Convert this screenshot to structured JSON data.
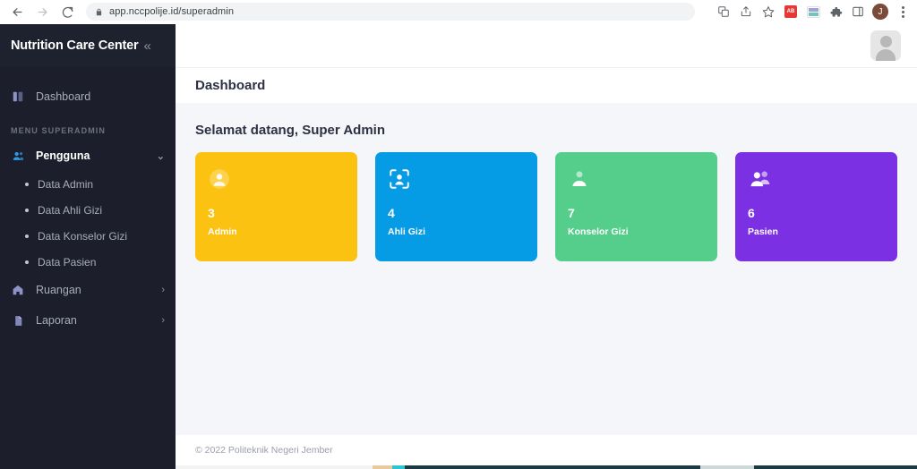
{
  "browser": {
    "back_label": "Back",
    "forward_label": "Forward",
    "reload_label": "Reload",
    "lock_icon": "lock-icon",
    "url": "app.nccpolije.id/superadmin",
    "toolbar_icons": [
      {
        "name": "translate-icon",
        "label": "Translate"
      },
      {
        "name": "share-icon",
        "label": "Share"
      },
      {
        "name": "bookmark-star-icon",
        "label": "Bookmark this tab"
      },
      {
        "name": "extension-red-icon",
        "label": "AdBlock",
        "badge": "AB"
      },
      {
        "name": "extension-wave-icon",
        "label": "Wave extension"
      },
      {
        "name": "extensions-puzzle-icon",
        "label": "Extensions"
      },
      {
        "name": "sidepanel-icon",
        "label": "Side panel"
      }
    ],
    "profile_initial": "J",
    "menu_label": "Customize and control Google Chrome"
  },
  "sidebar": {
    "brand": "Nutrition Care Center",
    "collapse_icon": "«",
    "items": [
      {
        "label": "Dashboard",
        "icon": "dashboard-icon",
        "type": "item"
      }
    ],
    "section_label": "MENU SUPERADMIN",
    "menu": [
      {
        "label": "Pengguna",
        "icon": "users-icon",
        "chevron": "⌄",
        "active": true
      },
      {
        "label": "Data Admin",
        "type": "sub"
      },
      {
        "label": "Data Ahli Gizi",
        "type": "sub"
      },
      {
        "label": "Data Konselor Gizi",
        "type": "sub"
      },
      {
        "label": "Data Pasien",
        "type": "sub"
      },
      {
        "label": "Ruangan",
        "icon": "home-icon",
        "chevron": "›"
      },
      {
        "label": "Laporan",
        "icon": "document-icon",
        "chevron": "›"
      }
    ]
  },
  "topbar": {
    "avatar_name": "user-avatar"
  },
  "page": {
    "title": "Dashboard",
    "welcome": "Selamat datang, Super Admin"
  },
  "cards": [
    {
      "count": "3",
      "label": "Admin",
      "color": "#FCC211",
      "icon": "user-circle-icon"
    },
    {
      "count": "4",
      "label": "Ahli Gizi",
      "color": "#059BE5",
      "icon": "face-scan-icon"
    },
    {
      "count": "7",
      "label": "Konselor Gizi",
      "color": "#55CE8C",
      "icon": "person-icon"
    },
    {
      "count": "6",
      "label": "Pasien",
      "color": "#7B30E3",
      "icon": "people-icon"
    }
  ],
  "footer": {
    "text": "© 2022  Politeknik Negeri Jember"
  },
  "colors": {
    "sidebar_bg": "#1C1F2B",
    "content_bg": "#F4F6F9",
    "text_dark": "#2D3142",
    "accent_blue": "#2F9BE8"
  }
}
